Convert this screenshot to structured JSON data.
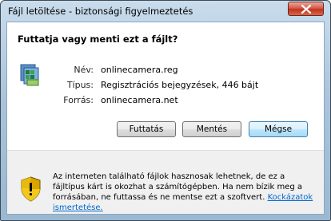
{
  "window": {
    "title": "Fájl letöltése - biztonsági figyelmeztetés",
    "close_icon": "close-icon"
  },
  "dialog": {
    "question": "Futtatja vagy menti ezt a fájlt?",
    "file_icon": "registry-file-icon",
    "fields": {
      "name_label": "Név:",
      "name_value": "onlinecamera.reg",
      "type_label": "Típus:",
      "type_value": "Regisztrációs bejegyzések, 446 bájt",
      "source_label": "Forrás:",
      "source_value": "onlinecamera.net"
    },
    "buttons": {
      "run": "Futtatás",
      "save": "Mentés",
      "cancel": "Mégse"
    }
  },
  "warning": {
    "icon": "security-shield-icon",
    "text": "Az interneten található fájlok hasznosak lehetnek, de ez a fájltípus kárt is okozhat a számítógépben. Ha nem bízik meg a forrásában, ne futtassa és ne mentse ezt a szoftvert.",
    "link": "Kockázatok ismertetése."
  }
}
